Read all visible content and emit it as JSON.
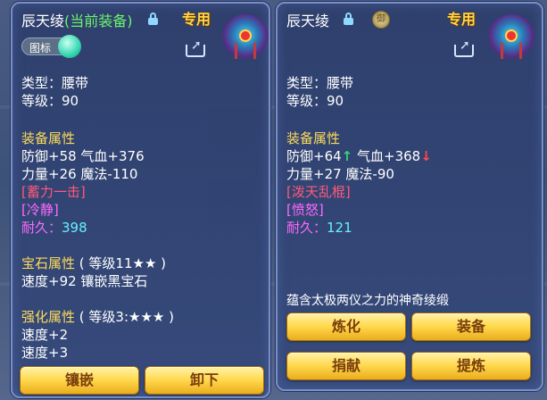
{
  "left_panel": {
    "item_name": "辰天绫",
    "equipped_tag": "(当前装备)",
    "exclusive_label": "专用",
    "emblem_toggle_label": "图标",
    "type_line": "类型：腰带",
    "level_line": "等级：90",
    "equip_attr_title": "装备属性",
    "attr_line_1": "防御+58 气血+376",
    "attr_line_2": "力量+26 魔法-110",
    "special_skill": "[蓄力一击]",
    "special_effect": "[冷静]",
    "durability_label": "耐久：",
    "durability_value": "398",
    "gem_attr_title": "宝石属性",
    "gem_level_text": "( 等级11★★ )",
    "gem_line": "速度+92 镶嵌黑宝石",
    "enhance_attr_title": "强化属性",
    "enhance_level_text": "( 等级3:★★★ )",
    "enhance_line_1": "速度+2",
    "enhance_line_2": "速度+3",
    "buttons": {
      "inlay": "镶嵌",
      "unequip": "卸下"
    }
  },
  "right_panel": {
    "item_name": "辰天绫",
    "seal_glyph": "御",
    "exclusive_label": "专用",
    "type_line": "类型：腰带",
    "level_line": "等级：90",
    "equip_attr_title": "装备属性",
    "attr_def": "防御+64",
    "attr_hp": "气血+368",
    "attr_line_2": "力量+27 魔法-90",
    "special_skill": "[泼天乱棍]",
    "special_effect": "[愤怒]",
    "durability_label": "耐久：",
    "durability_value": "121",
    "description": "蕴含太极两仪之力的神奇绫缎",
    "buttons": {
      "refine": "炼化",
      "equip": "装备",
      "donate": "捐献",
      "extract": "提炼"
    }
  },
  "icons": {
    "lock": "lock-icon",
    "share": "share-icon",
    "up": "↑",
    "down": "↓"
  },
  "colors": {
    "equipped": "#6cf36c",
    "gold_title": "#ffdc5a",
    "special_skill": "#ff5a7a",
    "special_effect": "#ff6aff",
    "durability": "#66f0ff",
    "button": "#ffd74a"
  }
}
